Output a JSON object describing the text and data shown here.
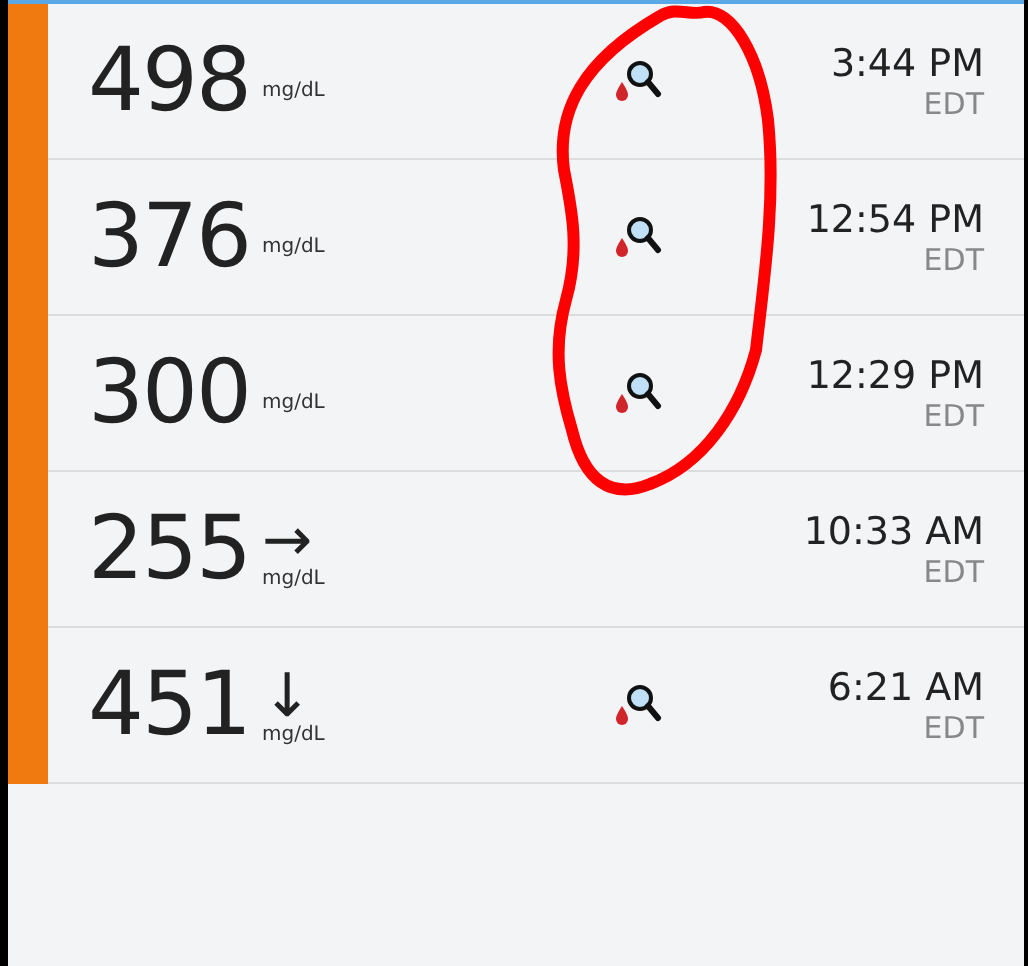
{
  "readings": [
    {
      "value": "498",
      "unit": "mg/dL",
      "fingerstick": true,
      "time": "3:44 PM",
      "zone": "EDT"
    },
    {
      "value": "376",
      "unit": "mg/dL",
      "fingerstick": true,
      "time": "12:54 PM",
      "zone": "EDT"
    },
    {
      "value": "300",
      "unit": "mg/dL",
      "fingerstick": true,
      "time": "12:29 PM",
      "zone": "EDT"
    },
    {
      "value": "255",
      "unit": "mg/dL",
      "trend_arrow": "→",
      "fingerstick": false,
      "time": "10:33 AM",
      "zone": "EDT"
    },
    {
      "value": "451",
      "unit": "mg/dL",
      "trend_arrow": "↓",
      "fingerstick": true,
      "time": "6:21 AM",
      "zone": "EDT"
    }
  ]
}
